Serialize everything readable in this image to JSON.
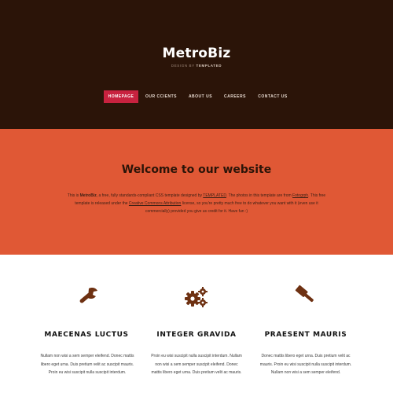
{
  "header": {
    "logo": "MetroBiz",
    "tagline_prefix": "DESIGN BY ",
    "tagline_brand": "TEMPLATED"
  },
  "nav": {
    "items": [
      {
        "label": "HOMEPAGE",
        "active": true
      },
      {
        "label": "OUR CCIENTS",
        "active": false
      },
      {
        "label": "ABOUT US",
        "active": false
      },
      {
        "label": "CAREERS",
        "active": false
      },
      {
        "label": "CONTACT US",
        "active": false
      }
    ]
  },
  "banner": {
    "title": "Welcome to our website",
    "text": {
      "p1": "This is ",
      "brand": "MetroBiz",
      "p2": ", a free, fully standards-compliant CSS template designed by ",
      "link1": "TEMPLATED",
      "p3": ". The photos in this template are from ",
      "link2": "Fotogrph",
      "p4": ". This free template is released under the ",
      "link3": "Creative Commons Attribution",
      "p5": " license, so you're pretty much free to do whatever you want with it (even use it commercially) provided you give us credit for it. Have fun :)"
    }
  },
  "features": [
    {
      "icon": "wrench-icon",
      "title": "MAECENAS LUCTUS",
      "text": "Nullam non wisi a sem semper eleifend. Donec mattis libero eget urna. Duis pretium velit ac suscipit mauris. Proin eu wisi suscipit nulla suscipit interdum."
    },
    {
      "icon": "gears-icon",
      "title": "INTEGER GRAVIDA",
      "text": "Proin eu wisi suscipit nulla suscipit interdum. Nullam non wisi a sem semper suscipit eleifend. Donec mattis libero eget urna. Duis pretium velit ac mauris."
    },
    {
      "icon": "gavel-icon",
      "title": "PRAESENT MAURIS",
      "text": "Donec mattis libero eget urna. Duis pretium velit ac mauris. Proin eu wisi suscipit nulla suscipit interdum. Nullam non wisi a sem semper eleifend."
    }
  ],
  "colors": {
    "header_bg": "#2b1408",
    "banner_bg": "#e05835",
    "nav_active": "#c8223f",
    "icon": "#6e3112"
  }
}
